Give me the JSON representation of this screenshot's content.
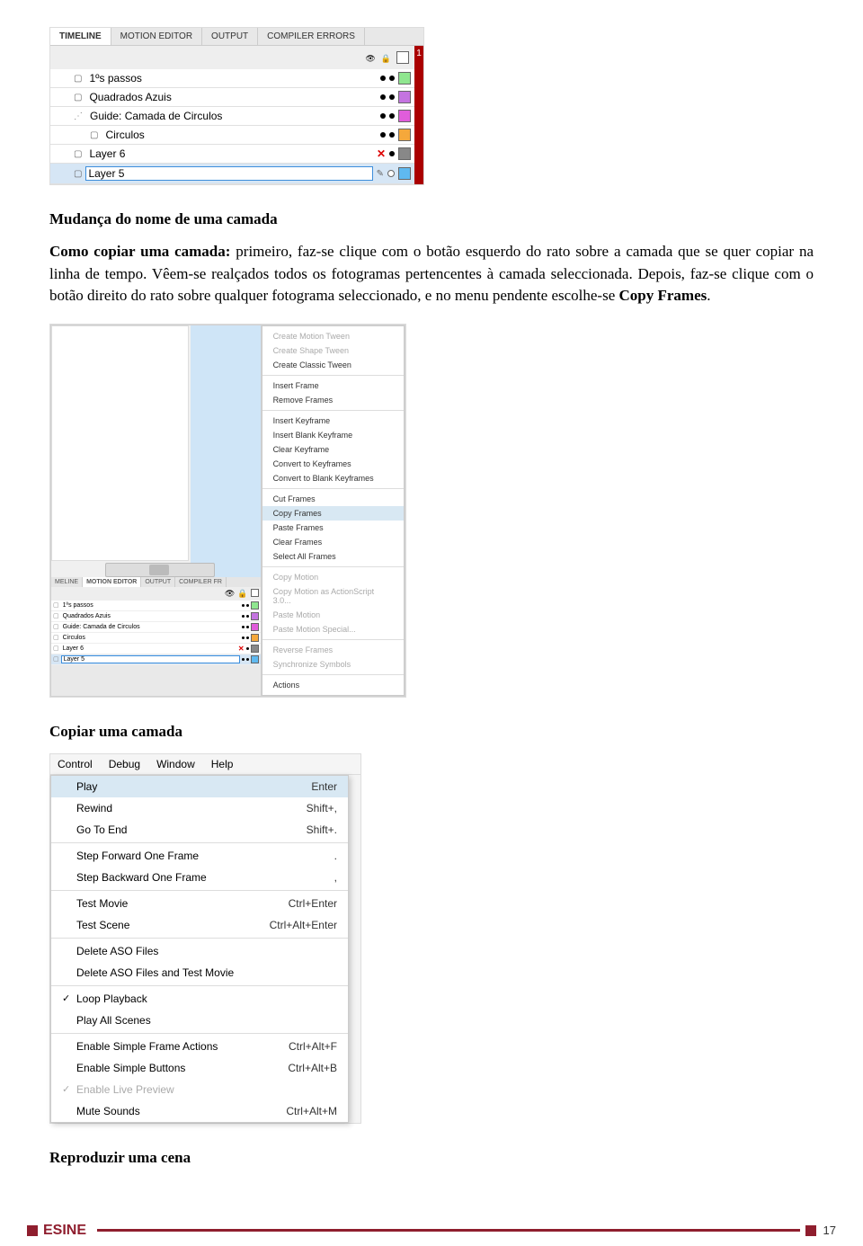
{
  "fig1": {
    "tabs": [
      "TIMELINE",
      "MOTION EDITOR",
      "OUTPUT",
      "COMPILER ERRORS"
    ],
    "header_digit": "1",
    "layers": [
      {
        "name": "1ºs passos",
        "indent": 1,
        "type": "page",
        "dots": [
          "dot",
          "dot"
        ],
        "color": "#8fe68f",
        "editing": false,
        "sel": false,
        "x": false,
        "pencil": false
      },
      {
        "name": "Quadrados Azuis",
        "indent": 1,
        "type": "page",
        "dots": [
          "dot",
          "dot"
        ],
        "color": "#c474e0",
        "editing": false,
        "sel": false,
        "x": false,
        "pencil": false
      },
      {
        "name": "Guide: Camada de Circulos",
        "indent": 1,
        "type": "guide",
        "dots": [
          "dot",
          "dot"
        ],
        "color": "#e05ddb",
        "editing": false,
        "sel": false,
        "x": false,
        "pencil": false
      },
      {
        "name": "Circulos",
        "indent": 2,
        "type": "page",
        "dots": [
          "dot",
          "dot"
        ],
        "color": "#f5a83b",
        "editing": false,
        "sel": false,
        "x": false,
        "pencil": false
      },
      {
        "name": "Layer 6",
        "indent": 1,
        "type": "page",
        "dots": [
          "x",
          "dot"
        ],
        "color": "#888888",
        "editing": false,
        "sel": false,
        "x": true,
        "pencil": false
      },
      {
        "name": "Layer 5",
        "indent": 1,
        "type": "page",
        "dots": [
          "dotw",
          "dotw"
        ],
        "color": "#5fb9f0",
        "editing": true,
        "sel": true,
        "x": false,
        "pencil": true
      }
    ]
  },
  "heading1": "Mudança do nome de uma camada",
  "para1_pre": "Como copiar uma camada:",
  "para1_post_a": " primeiro, faz-se clique com o botão esquerdo do rato sobre a camada que se quer copiar na linha de tempo. Vêem-se realçados todos os fotogramas pertencentes à camada seleccionada. Depois, faz-se clique com o botão direito do rato sobre qualquer fotograma seleccionado, e no menu pendente escolhe-se ",
  "para1_bold": "Copy Frames",
  "para1_end": ".",
  "fig2": {
    "tabs_mini": [
      "MELINE",
      "MOTION EDITOR",
      "OUTPUT",
      "COMPILER FR"
    ],
    "layers": [
      {
        "name": "1ºs passos",
        "color": "#8fe68f",
        "x": false,
        "sel": false,
        "editing": false
      },
      {
        "name": "Quadrados Azuis",
        "color": "#c474e0",
        "x": false,
        "sel": false,
        "editing": false
      },
      {
        "name": "Guide: Camada de Circulos",
        "color": "#e05ddb",
        "x": false,
        "sel": false,
        "editing": false
      },
      {
        "name": "Circulos",
        "color": "#f5a83b",
        "x": false,
        "sel": false,
        "editing": false
      },
      {
        "name": "Layer 6",
        "color": "#888888",
        "x": true,
        "sel": false,
        "editing": false
      },
      {
        "name": "Layer 5",
        "color": "#5fb9f0",
        "x": false,
        "sel": true,
        "editing": true
      }
    ],
    "ctx": [
      {
        "t": "Create Motion Tween",
        "dis": true
      },
      {
        "t": "Create Shape Tween",
        "dis": true
      },
      {
        "t": "Create Classic Tween",
        "dis": false
      },
      {
        "sep": true
      },
      {
        "t": "Insert Frame",
        "dis": false
      },
      {
        "t": "Remove Frames",
        "dis": false
      },
      {
        "sep": true
      },
      {
        "t": "Insert Keyframe",
        "dis": false
      },
      {
        "t": "Insert Blank Keyframe",
        "dis": false
      },
      {
        "t": "Clear Keyframe",
        "dis": false
      },
      {
        "t": "Convert to Keyframes",
        "dis": false
      },
      {
        "t": "Convert to Blank Keyframes",
        "dis": false
      },
      {
        "sep": true
      },
      {
        "t": "Cut Frames",
        "dis": false
      },
      {
        "t": "Copy Frames",
        "dis": false,
        "hl": true
      },
      {
        "t": "Paste Frames",
        "dis": false
      },
      {
        "t": "Clear Frames",
        "dis": false
      },
      {
        "t": "Select All Frames",
        "dis": false
      },
      {
        "sep": true
      },
      {
        "t": "Copy Motion",
        "dis": true
      },
      {
        "t": "Copy Motion as ActionScript 3.0...",
        "dis": true
      },
      {
        "t": "Paste Motion",
        "dis": true
      },
      {
        "t": "Paste Motion Special...",
        "dis": true
      },
      {
        "sep": true
      },
      {
        "t": "Reverse Frames",
        "dis": true
      },
      {
        "t": "Synchronize Symbols",
        "dis": true
      },
      {
        "sep": true
      },
      {
        "t": "Actions",
        "dis": false
      }
    ]
  },
  "heading2": "Copiar uma camada",
  "fig3": {
    "menubar": [
      "Control",
      "Debug",
      "Window",
      "Help"
    ],
    "items": [
      {
        "lbl": "Play",
        "sc": "Enter",
        "hl": true
      },
      {
        "lbl": "Rewind",
        "sc": "Shift+,"
      },
      {
        "lbl": "Go To End",
        "sc": "Shift+."
      },
      {
        "sep": true
      },
      {
        "lbl": "Step Forward One Frame",
        "sc": "."
      },
      {
        "lbl": "Step Backward One Frame",
        "sc": ","
      },
      {
        "sep": true
      },
      {
        "lbl": "Test Movie",
        "sc": "Ctrl+Enter"
      },
      {
        "lbl": "Test Scene",
        "sc": "Ctrl+Alt+Enter"
      },
      {
        "sep": true
      },
      {
        "lbl": "Delete ASO Files",
        "sc": ""
      },
      {
        "lbl": "Delete ASO Files and Test Movie",
        "sc": ""
      },
      {
        "sep": true
      },
      {
        "lbl": "Loop Playback",
        "sc": "",
        "chk": true
      },
      {
        "lbl": "Play All Scenes",
        "sc": ""
      },
      {
        "sep": true
      },
      {
        "lbl": "Enable Simple Frame Actions",
        "sc": "Ctrl+Alt+F"
      },
      {
        "lbl": "Enable Simple Buttons",
        "sc": "Ctrl+Alt+B"
      },
      {
        "lbl": "Enable Live Preview",
        "sc": "",
        "chk": true,
        "dis": true
      },
      {
        "lbl": "Mute Sounds",
        "sc": "Ctrl+Alt+M"
      }
    ]
  },
  "heading3": "Reproduzir uma cena",
  "footer": {
    "brand": "ESINE",
    "page": "17"
  }
}
